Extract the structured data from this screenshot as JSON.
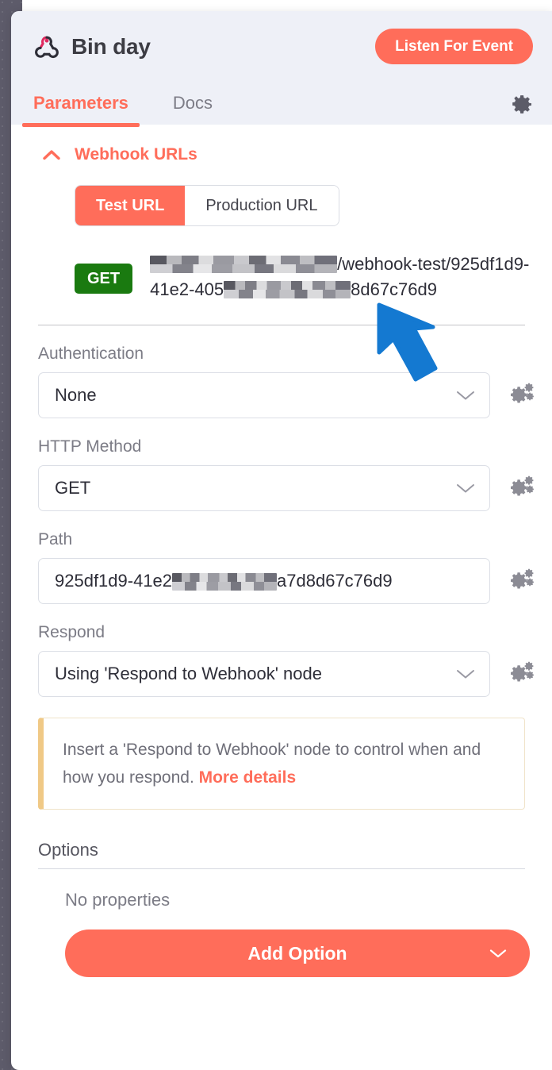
{
  "header": {
    "node_icon": "webhook-icon",
    "title": "Bin day",
    "listen_button": "Listen For Event",
    "settings_icon": "gear-icon",
    "tabs": [
      {
        "label": "Parameters",
        "active": true
      },
      {
        "label": "Docs",
        "active": false
      }
    ]
  },
  "webhook_section": {
    "collapse_icon": "chevron-up-icon",
    "title": "Webhook URLs",
    "url_toggle": [
      {
        "label": "Test URL",
        "active": true
      },
      {
        "label": "Production URL",
        "active": false
      }
    ],
    "method_badge": "GET",
    "url": {
      "redacted_host": true,
      "visible_path": "/webhook-test/925df1d9-41e2-405",
      "visible_tail": "8d67c76d9"
    }
  },
  "fields": [
    {
      "label": "Authentication",
      "value": "None",
      "type": "select",
      "caret_icon": "chevron-down-icon",
      "settings_icon": "cogs-icon"
    },
    {
      "label": "HTTP Method",
      "value": "GET",
      "type": "select",
      "caret_icon": "chevron-down-icon",
      "settings_icon": "cogs-icon"
    },
    {
      "label": "Path",
      "value_prefix": "925df1d9-41e2",
      "value_suffix": "a7d8d67c76d9",
      "type": "text",
      "settings_icon": "cogs-icon"
    },
    {
      "label": "Respond",
      "value": "Using 'Respond to Webhook' node",
      "type": "select",
      "caret_icon": "chevron-down-icon",
      "settings_icon": "cogs-icon"
    }
  ],
  "notice": {
    "text": "Insert a 'Respond to Webhook' node to control when and how you respond. ",
    "link_label": "More details"
  },
  "options": {
    "title": "Options",
    "empty_text": "No properties",
    "add_button": "Add Option",
    "add_button_caret": "chevron-down-icon"
  },
  "annotation": {
    "pointer_icon": "blue-arrow-pointer",
    "color": "#1479d1"
  },
  "colors": {
    "accent": "#ff6d5a",
    "header_bg": "#eef0f7",
    "method_get": "#1a7a10",
    "notice_border": "#f0c986",
    "canvas": "#5d5b6a"
  }
}
